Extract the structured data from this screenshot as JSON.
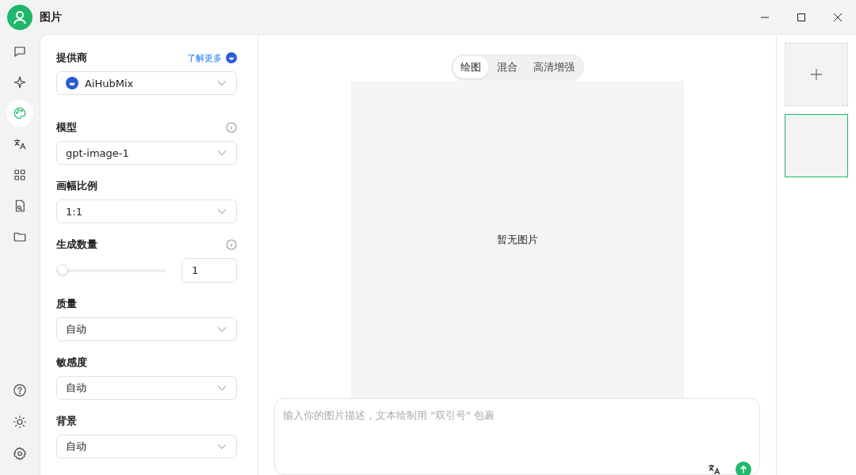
{
  "window": {
    "title": "图片"
  },
  "nav": [
    {
      "kind": "chat",
      "selected": false
    },
    {
      "kind": "sparkle",
      "selected": false
    },
    {
      "kind": "palette",
      "selected": true
    },
    {
      "kind": "translate",
      "selected": false
    },
    {
      "kind": "grid",
      "selected": false
    },
    {
      "kind": "file-search",
      "selected": false
    },
    {
      "kind": "folder",
      "selected": false
    }
  ],
  "nav_bottom": [
    {
      "kind": "help"
    },
    {
      "kind": "sun"
    },
    {
      "kind": "gear"
    }
  ],
  "settings": [
    {
      "kind": "select",
      "label": "提供商",
      "link": "了解更多",
      "value": "AiHubMix",
      "provider_icon": true
    },
    {
      "kind": "select",
      "label": "模型",
      "info": true,
      "value": "gpt-image-1"
    },
    {
      "kind": "select",
      "label": "画幅比例",
      "value": "1:1"
    },
    {
      "kind": "slider",
      "label": "生成数量",
      "info": true,
      "level": 0,
      "value": "1"
    },
    {
      "kind": "select",
      "label": "质量",
      "value": "自动"
    },
    {
      "kind": "select",
      "label": "敏感度",
      "value": "自动"
    },
    {
      "kind": "select",
      "label": "背景",
      "value": "自动"
    }
  ],
  "tabs": [
    {
      "label": "绘图",
      "selected": true
    },
    {
      "label": "混合",
      "selected": false
    },
    {
      "label": "高清增强",
      "selected": false
    }
  ],
  "canvas": {
    "empty_text": "暂无图片"
  },
  "prompt": {
    "placeholder": "输入你的图片描述，文本绘制用 \"双引号\" 包裹"
  },
  "thumbnails": [
    {
      "kind": "add",
      "selected": false
    },
    {
      "kind": "image",
      "selected": true
    }
  ]
}
